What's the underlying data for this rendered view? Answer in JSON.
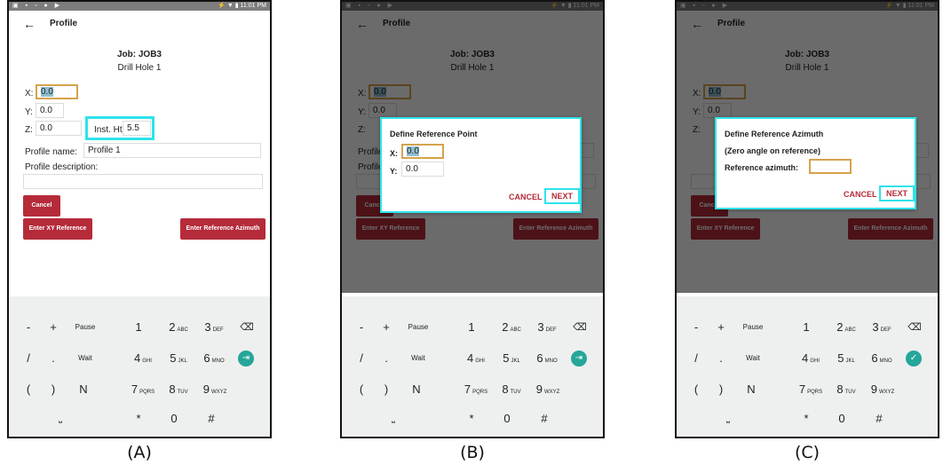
{
  "status_bar": {
    "left_icons": "▣ ▪ ▫ ● ▶",
    "right": "⚡ ▼ ▮ 11:01 PM"
  },
  "app_bar": {
    "title": "Profile",
    "back_icon": "←"
  },
  "form": {
    "job": "Job: JOB3",
    "hole": "Drill Hole 1",
    "x_label": "X:",
    "x_value": "0.0",
    "y_label": "Y:",
    "y_value": "0.0",
    "z_label": "Z:",
    "z_value": "0.0",
    "inst_label": "Inst. Ht:",
    "inst_value": "5.5",
    "profile_name_label": "Profile name:",
    "profile_name_value": "Profile 1",
    "profile_desc_label": "Profile description:",
    "cancel_button": "Cancel",
    "xy_ref_button": "Enter XY Reference",
    "azimuth_button": "Enter Reference Azimuth"
  },
  "keypad": {
    "row1": {
      "minus": "-",
      "plus": "+",
      "pause": "Pause",
      "k1": "1",
      "k2": "2",
      "k2s": "ABC",
      "k3": "3",
      "k3s": "DEF",
      "backspace": "⌫"
    },
    "row2": {
      "slash": "/",
      "dot": ".",
      "wait": "Wait",
      "k4": "4",
      "k4s": "GHI",
      "k5": "5",
      "k5s": "JKL",
      "k6": "6",
      "k6s": "MNO",
      "tab": "⇥",
      "done": "✓"
    },
    "row3": {
      "lparen": "(",
      "rparen": ")",
      "n": "N",
      "k7": "7",
      "k7s": "PQRS",
      "k8": "8",
      "k8s": "TUV",
      "k9": "9",
      "k9s": "WXYZ"
    },
    "row4": {
      "space": "⎵",
      "star": "*",
      "k0": "0",
      "hash": "#"
    }
  },
  "dialog_b": {
    "title": "Define Reference Point",
    "x_label": "X:",
    "x_value": "0.0",
    "y_label": "Y:",
    "y_value": "0.0",
    "cancel": "CANCEL",
    "next": "NEXT"
  },
  "dialog_c": {
    "title": "Define Reference Azimuth",
    "subtitle": "(Zero angle on reference)",
    "azimuth_label": "Reference azimuth:",
    "azimuth_value": "",
    "cancel": "CANCEL",
    "next": "NEXT"
  },
  "captions": {
    "a": "(A)",
    "b": "(B)",
    "c": "(C)"
  },
  "colors": {
    "accent_red": "#b52b39",
    "highlight_cyan": "#2fe3ea",
    "focus_orange": "#d6a24d",
    "keypad_bg": "#eeefef",
    "action_teal": "#26a69a"
  }
}
